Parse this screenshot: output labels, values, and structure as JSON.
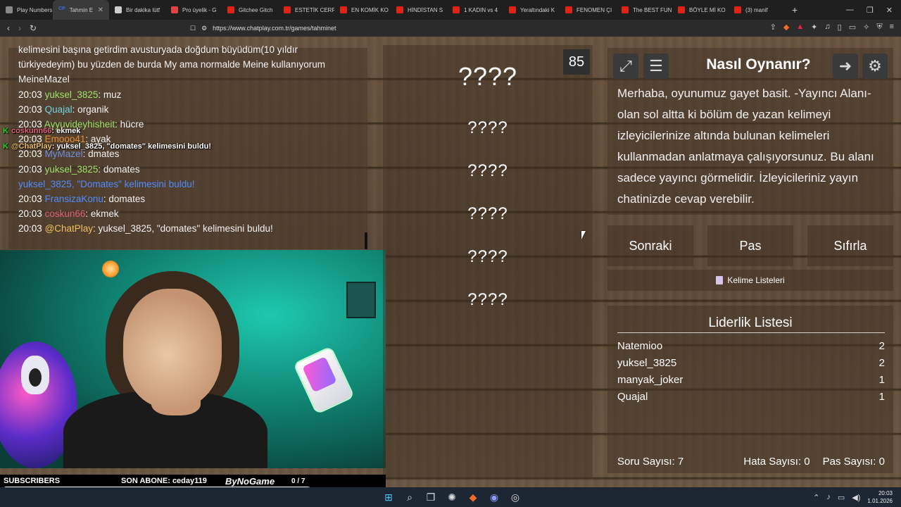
{
  "browser": {
    "tabs": [
      {
        "title": "Play Numbers",
        "color": "#888888"
      },
      {
        "title": "Tahmin E",
        "color": "#3c6fd8",
        "active": true,
        "fav_text": "CP"
      },
      {
        "title": "Bir dakika lütf",
        "color": "#cccccc"
      },
      {
        "title": "Pro üyelik - G",
        "color": "#e24444"
      },
      {
        "title": "Gitchee Gitch",
        "color": "#e62117"
      },
      {
        "title": "ESTETİK CERR",
        "color": "#e62117"
      },
      {
        "title": "EN KOMİK KO",
        "color": "#e62117"
      },
      {
        "title": "HİNDİSTAN S",
        "color": "#e62117"
      },
      {
        "title": "1 KADIN vs 4",
        "color": "#e62117"
      },
      {
        "title": "Yeraltındaki K",
        "color": "#e62117"
      },
      {
        "title": "FENOMEN ÇI",
        "color": "#e62117"
      },
      {
        "title": "The BEST FUN",
        "color": "#e62117"
      },
      {
        "title": "BÖYLE Mİ KO",
        "color": "#e62117"
      },
      {
        "title": "(3) manif",
        "color": "#e62117"
      }
    ],
    "url": "https://www.chatplay.com.tr/games/tahminet"
  },
  "chat": {
    "intro": "kelimesini başına getirdim avusturyada doğdum büyüdüm(10 yıldır türkiyedeyim) bu yüzden de burda My ama normalde Meine kullanıyorum MeineMazel",
    "messages": [
      {
        "time": "20:03",
        "user": "yuksel_3825",
        "color": "#9be36a",
        "text": ": muz"
      },
      {
        "time": "20:03",
        "user": "Quajal",
        "color": "#6fd4e0",
        "text": ": organik"
      },
      {
        "time": "20:03",
        "user": "Ayyuvideyhisheit",
        "color": "#9be36a",
        "text": ": hücre"
      },
      {
        "time": "20:03",
        "user": "Emooo41",
        "color": "#e88b2e",
        "text": ": ayak"
      },
      {
        "time": "20:03",
        "user": "MyMazel",
        "color": "#6f8ee0",
        "text": ": dmates"
      },
      {
        "time": "20:03",
        "user": "yuksel_3825",
        "color": "#9be36a",
        "text": ": domates"
      },
      {
        "time": "",
        "user": "yuksel_3825",
        "color": "#4f8cff",
        "text": ", \"Domates\" kelimesini buldu!",
        "system": true
      },
      {
        "time": "20:03",
        "user": "FransizaKonu",
        "color": "#4f8cff",
        "text": ": domates"
      },
      {
        "time": "20:03",
        "user": "coskun66",
        "color": "#e0607a",
        "text": ": ekmek"
      },
      {
        "time": "20:03",
        "user": "@ChatPlay",
        "color": "#f0c060",
        "text": ": yuksel_3825, \"domates\" kelimesini buldu!"
      }
    ],
    "overlay": [
      {
        "user": "coskunn66",
        "text": ": ekmek",
        "color": "#e0607a"
      },
      {
        "user": "@ChatPlay",
        "text": ": yuksel_3825, \"domates\" kelimesini buldu!",
        "color": "#f0c060"
      }
    ],
    "overlay_badge": "K"
  },
  "game": {
    "words": [
      "????",
      "????",
      "????",
      "????",
      "????",
      "????"
    ],
    "timer": "85"
  },
  "rules": {
    "title": "Nasıl Oynanır?",
    "text": "Merhaba, oyunumuz gayet basit. -Yayıncı Alanı- olan sol altta ki bölüm de yazan kelimeyi izleyicilerinize altında bulunan kelimeleri kullanmadan anlatmaya çalışıyorsunuz. Bu alanı sadece yayıncı görmelidir. İzleyicileriniz yayın chatinizde cevap verebilir.",
    "icons": [
      "fullscreen-icon",
      "list-icon",
      "exit-icon",
      "gear-icon"
    ]
  },
  "controls": {
    "next": "Sonraki",
    "pass": "Pas",
    "reset": "Sıfırla",
    "word_lists": "Kelime Listeleri"
  },
  "leaderboard": {
    "title": "Liderlik Listesi",
    "rows": [
      {
        "name": "Natemioo",
        "score": "2"
      },
      {
        "name": "yuksel_3825",
        "score": "2"
      },
      {
        "name": "manyak_joker",
        "score": "1"
      },
      {
        "name": "Quajal",
        "score": "1"
      }
    ],
    "question_count_label": "Soru Sayısı:",
    "question_count": "7",
    "error_count_label": "Hata Sayısı:",
    "error_count": "0",
    "pass_count_label": "Pas Sayısı:",
    "pass_count": "0"
  },
  "stream_overlay": {
    "subscribers": "SUBSCRIBERS",
    "last_sub_label": "SON ABONE:",
    "last_sub": "ceday119",
    "brand": "ByNoGame",
    "count": "0 / 7"
  },
  "taskbar": {
    "time": "20:03",
    "date": "1.01.2026"
  }
}
